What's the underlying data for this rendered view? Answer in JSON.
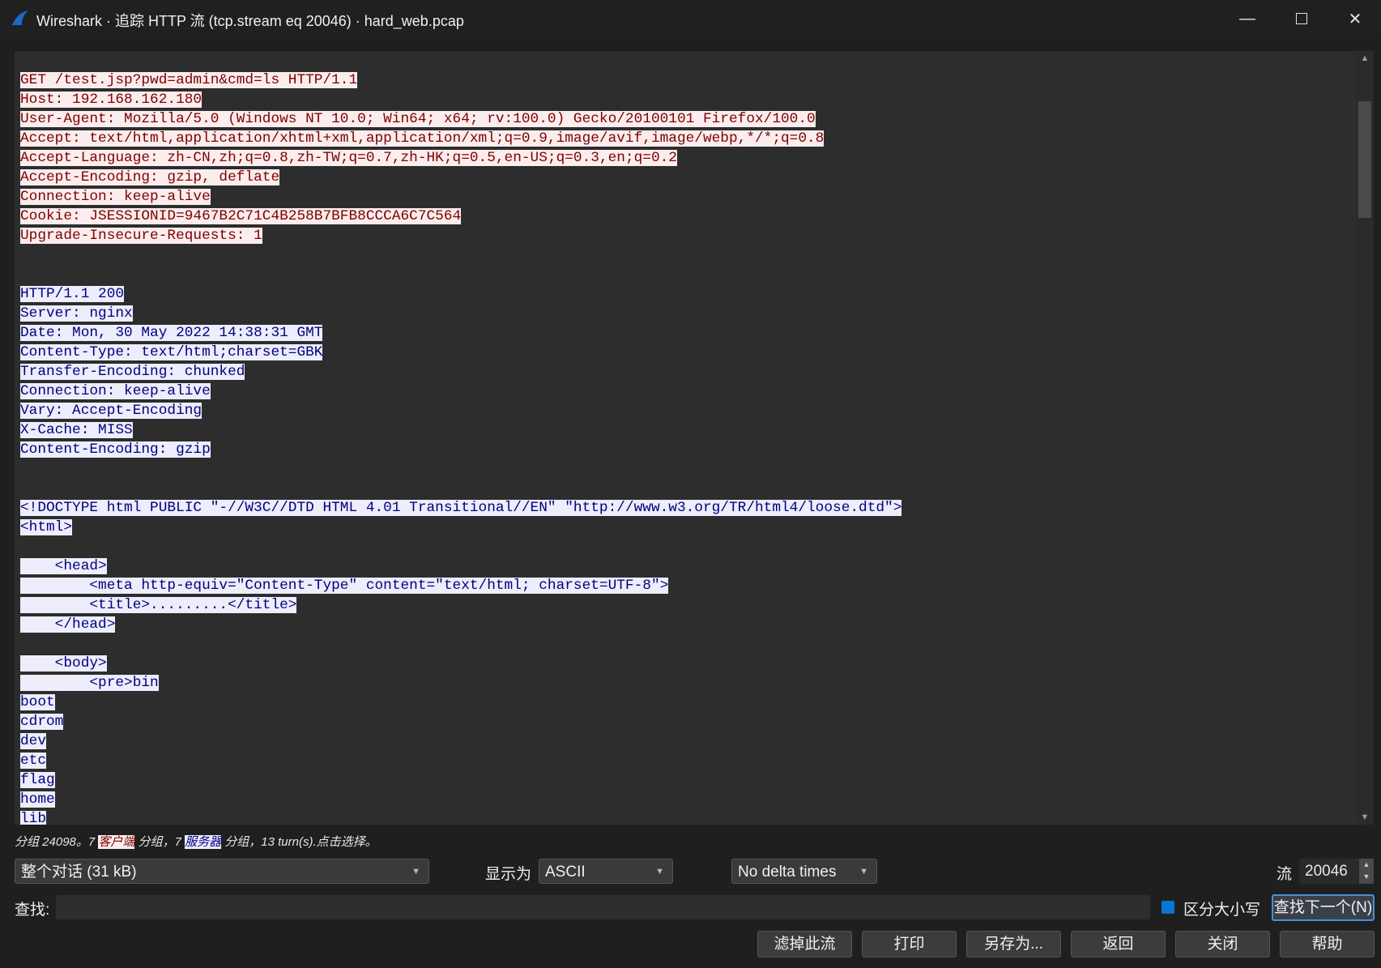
{
  "window": {
    "title": "Wireshark · 追踪 HTTP 流 (tcp.stream eq 20046) · hard_web.pcap"
  },
  "colors": {
    "client_bg": "#fbeded",
    "client_fg": "#7f0000",
    "server_bg": "#ededfb",
    "server_fg": "#00007f",
    "accent": "#0a74d6"
  },
  "stream": {
    "segments": [
      {
        "who": "client",
        "lines": [
          "GET /test.jsp?pwd=admin&cmd=ls HTTP/1.1",
          "Host: 192.168.162.180",
          "User-Agent: Mozilla/5.0 (Windows NT 10.0; Win64; x64; rv:100.0) Gecko/20100101 Firefox/100.0",
          "Accept: text/html,application/xhtml+xml,application/xml;q=0.9,image/avif,image/webp,*/*;q=0.8",
          "Accept-Language: zh-CN,zh;q=0.8,zh-TW;q=0.7,zh-HK;q=0.5,en-US;q=0.3,en;q=0.2",
          "Accept-Encoding: gzip, deflate",
          "Connection: keep-alive",
          "Cookie: JSESSIONID=9467B2C71C4B258B7BFB8CCCA6C7C564",
          "Upgrade-Insecure-Requests: 1",
          "",
          ""
        ]
      },
      {
        "who": "server",
        "lines": [
          "HTTP/1.1 200",
          "Server: nginx",
          "Date: Mon, 30 May 2022 14:38:31 GMT",
          "Content-Type: text/html;charset=GBK",
          "Transfer-Encoding: chunked",
          "Connection: keep-alive",
          "Vary: Accept-Encoding",
          "X-Cache: MISS",
          "Content-Encoding: gzip",
          "",
          "",
          "<!DOCTYPE html PUBLIC \"-//W3C//DTD HTML 4.01 Transitional//EN\" \"http://www.w3.org/TR/html4/loose.dtd\">",
          "<html>",
          "",
          "    <head>",
          "        <meta http-equiv=\"Content-Type\" content=\"text/html; charset=UTF-8\">",
          "        <title>.........</title>",
          "    </head>",
          "",
          "    <body>",
          "        <pre>bin",
          "boot",
          "cdrom",
          "dev",
          "etc",
          "flag",
          "home",
          "lib"
        ]
      }
    ]
  },
  "status": {
    "prefix": "分组 24098。7 ",
    "client_label": "客户端",
    "middle": " 分组，7 ",
    "server_label": "服务器",
    "suffix": " 分组，13 turn(s).点击选择。"
  },
  "controls": {
    "conversation": "整个对话 (31 kB)",
    "show_as_label": "显示为",
    "show_as": "ASCII",
    "delta": "No delta times",
    "stream_label": "流",
    "stream_value": "20046",
    "find_label": "查找:",
    "find_value": "",
    "case_label": "区分大小写",
    "find_next": "查找下一个(N)"
  },
  "buttons": {
    "filter_out": "滤掉此流",
    "print": "打印",
    "save_as": "另存为...",
    "back": "返回",
    "close": "关闭",
    "help": "帮助"
  }
}
